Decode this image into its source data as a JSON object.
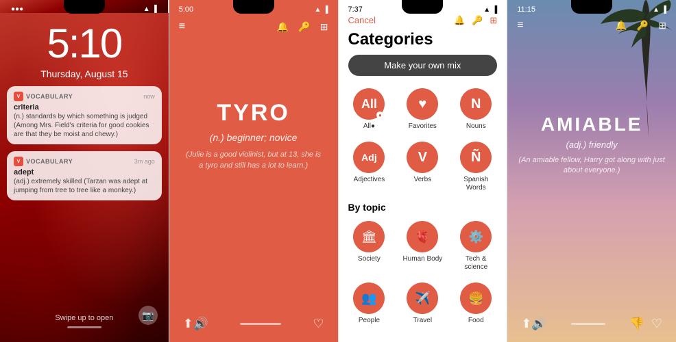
{
  "phone1": {
    "time": "5:10",
    "date": "Thursday, August 15",
    "notif1": {
      "app": "VOCABULARY",
      "time_label": "now",
      "title": "criteria",
      "body": "(n.) standards by which something is judged\n(Among Mrs. Field's criteria for good cookies are that they be moist and chewy.)"
    },
    "notif2": {
      "app": "VOCABULARY",
      "time_label": "3m ago",
      "title": "adept",
      "body": "(adj.) extremely skilled\n(Tarzan was adept at jumping from tree to tree like a monkey.)"
    },
    "swipe_hint": "Swipe up to open"
  },
  "phone2": {
    "time": "5:00",
    "word": "TYRO",
    "definition": "(n.) beginner; novice",
    "example": "(Julie is a good violinist, but at 13, she is a tyro and still has a lot to learn.)"
  },
  "phone3": {
    "time": "7:37",
    "cancel": "Cancel",
    "title": "Categories",
    "mix_button": "Make your own mix",
    "categories": [
      {
        "label": "All●",
        "icon": "All",
        "type": "letter"
      },
      {
        "label": "Favorites",
        "icon": "♥",
        "type": "icon"
      },
      {
        "label": "Nouns",
        "icon": "N",
        "type": "letter"
      },
      {
        "label": "Adjectives",
        "icon": "Adj",
        "type": "letter"
      },
      {
        "label": "Verbs",
        "icon": "V",
        "type": "letter"
      },
      {
        "label": "Spanish Words",
        "icon": "Ñ",
        "type": "letter"
      }
    ],
    "by_topic": "By topic",
    "topics": [
      {
        "label": "Society",
        "icon": "🏛"
      },
      {
        "label": "Human Body",
        "icon": "🫀"
      },
      {
        "label": "Tech & science",
        "icon": "⚙️"
      },
      {
        "label": "People",
        "icon": "👥"
      },
      {
        "label": "Travel",
        "icon": "✈️"
      },
      {
        "label": "Food",
        "icon": "🍔"
      }
    ]
  },
  "phone4": {
    "time": "11:15",
    "word": "AMIABLE",
    "definition": "(adj.) friendly",
    "example": "(An amiable fellow, Harry got along with just about everyone.)"
  }
}
